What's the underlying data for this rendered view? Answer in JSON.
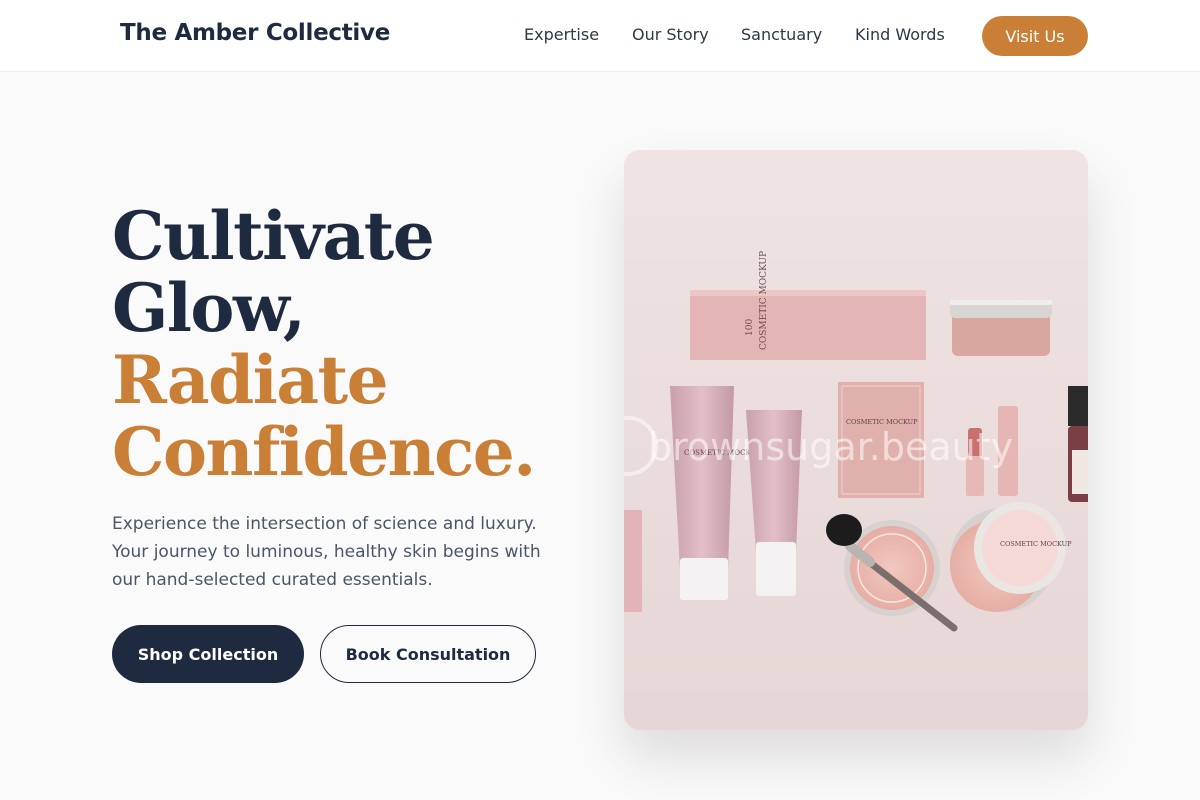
{
  "header": {
    "brand": "The Amber Collective",
    "nav": [
      "Expertise",
      "Our Story",
      "Sanctuary",
      "Kind Words"
    ],
    "cta": "Visit Us"
  },
  "hero": {
    "headline_dark": [
      "Cultivate",
      "Glow,"
    ],
    "headline_accent": [
      "Radiate",
      "Confidence."
    ],
    "description": "Experience the intersection of science and luxury. Your journey to luminous, healthy skin begins with our hand-selected curated essentials.",
    "primary_button": "Shop Collection",
    "secondary_button": "Book Consultation"
  },
  "product_image": {
    "watermark": "brownsugar.beauty",
    "box_label": "COSMETIC MOCKUP",
    "box_number": "100",
    "sachet_label": "COSMETIC MOCKUP",
    "tube_label": "COSMETIC MOCKUP",
    "compact_label": "COSMETIC MOCKUP"
  },
  "colors": {
    "navy": "#1e2a40",
    "amber": "#c97f35",
    "blush": "#e8c8c8",
    "background": "#fafafa"
  }
}
